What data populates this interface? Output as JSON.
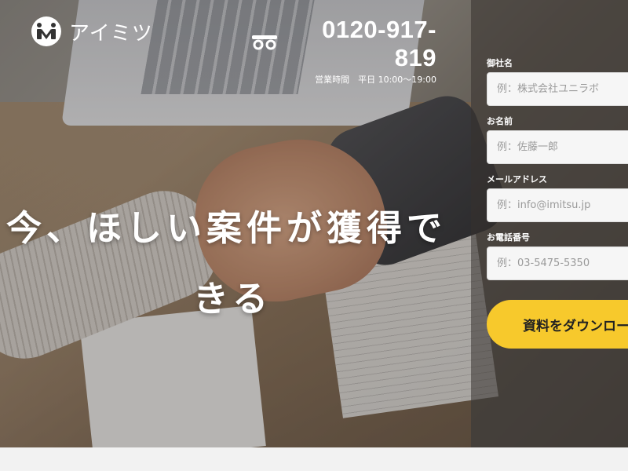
{
  "brand": {
    "logo_text": "アイミツ"
  },
  "contact": {
    "phone_number": "0120-917-819",
    "hours": "営業時間　平日 10:00〜19:00",
    "icon": "free-dial-icon"
  },
  "hero": {
    "headline_line1": "今、ほしい案件が獲得で",
    "headline_line2": "きる"
  },
  "form": {
    "fields": [
      {
        "label": "御社名",
        "placeholder": "例：株式会社ユニラボ"
      },
      {
        "label": "お名前",
        "placeholder": "例：佐藤一郎"
      },
      {
        "label": "メールアドレス",
        "placeholder": "例：info@imitsu.jp"
      },
      {
        "label": "お電話番号",
        "placeholder": "例：03-5475-5350"
      }
    ],
    "submit_label": "資料をダウンロード"
  },
  "colors": {
    "accent": "#f7c92c",
    "text_light": "#ffffff"
  }
}
